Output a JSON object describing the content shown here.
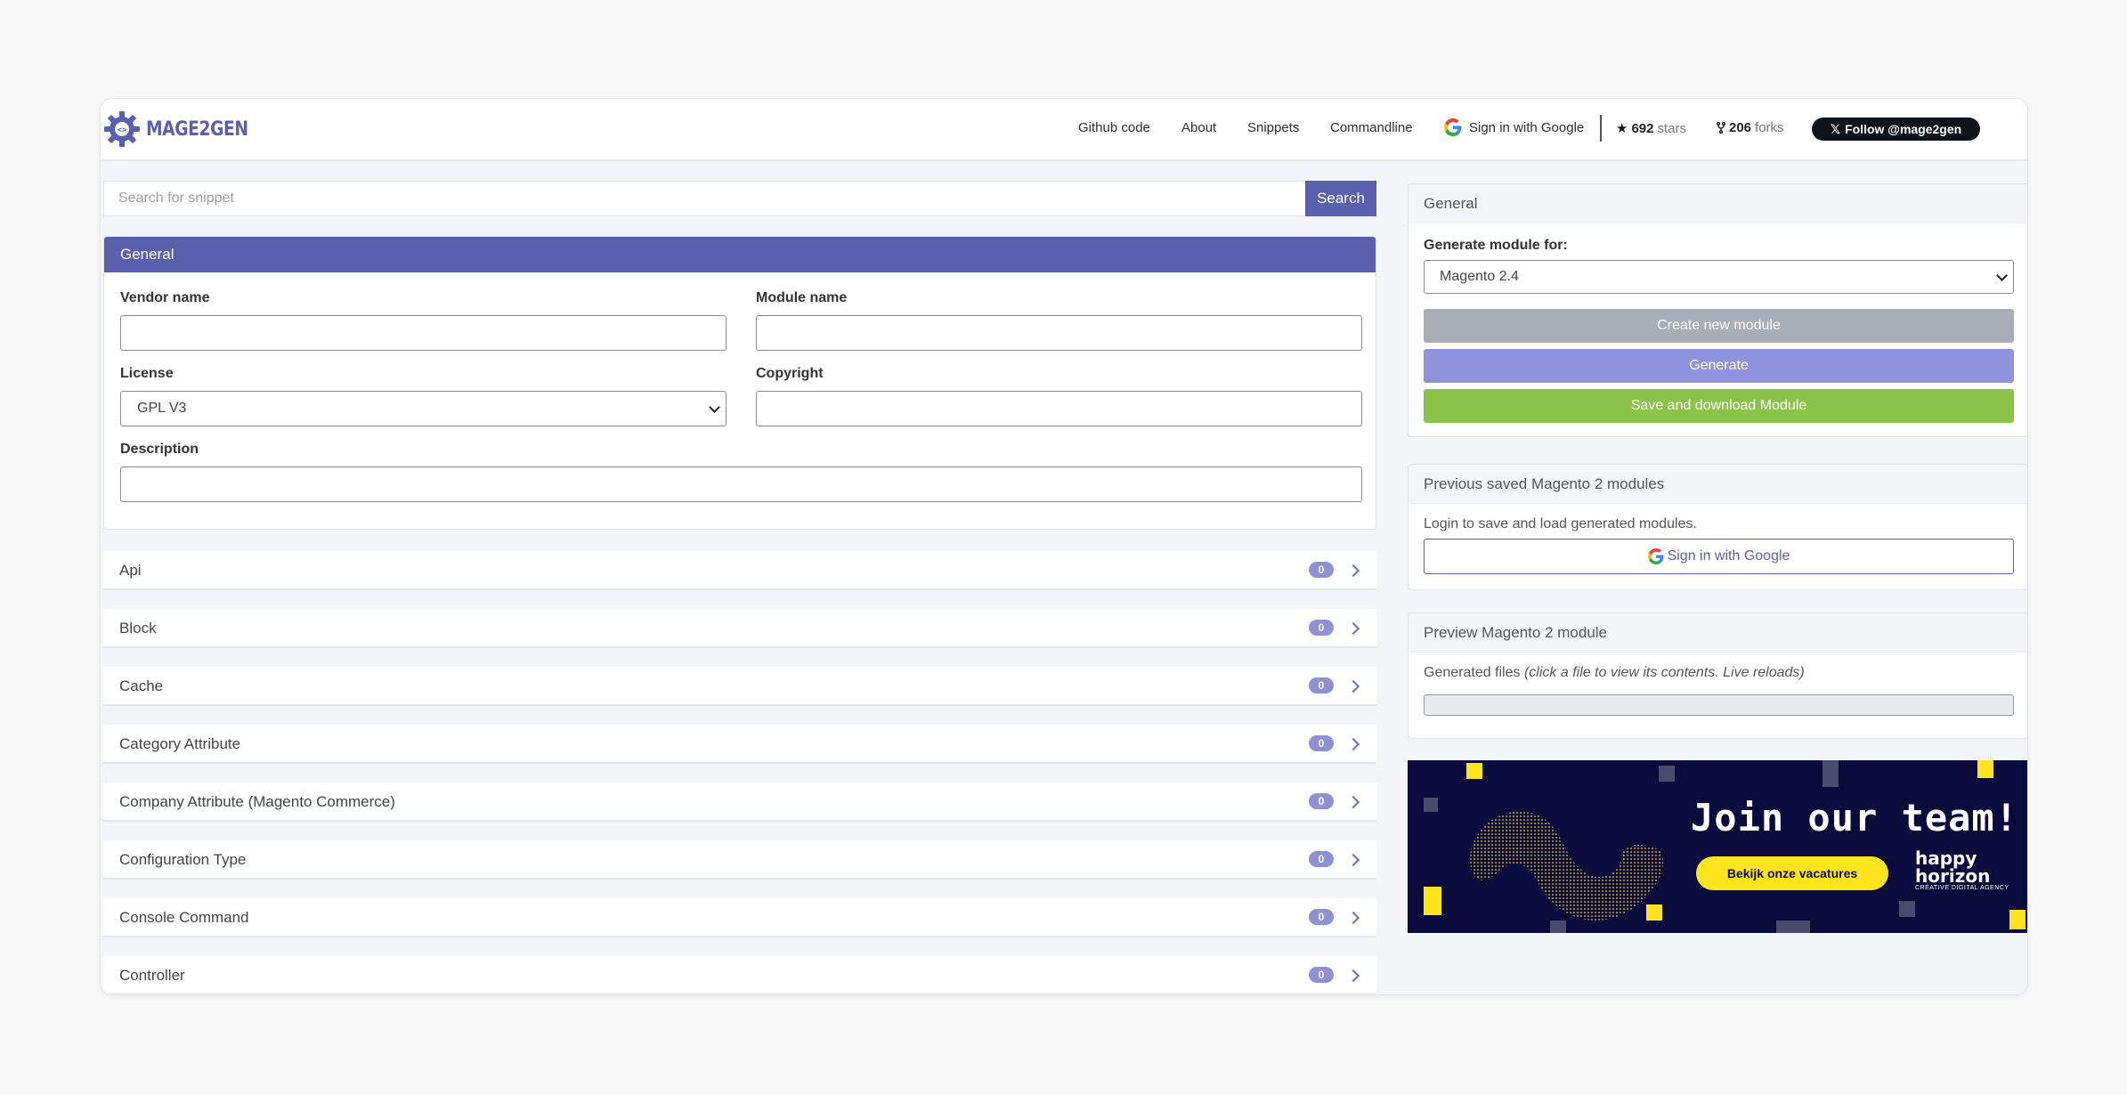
{
  "header": {
    "logo_text": "MAGE2GEN",
    "nav": [
      "Github code",
      "About",
      "Snippets",
      "Commandline"
    ],
    "sign_in_label": "Sign in with Google",
    "stars_count": "692",
    "stars_label": "stars",
    "forks_count": "206",
    "forks_label": "forks",
    "follow_label": "Follow @mage2gen"
  },
  "search": {
    "placeholder": "Search for snippet",
    "button_label": "Search"
  },
  "general": {
    "title": "General",
    "vendor_label": "Vendor name",
    "module_label": "Module name",
    "license_label": "License",
    "license_value": "GPL V3",
    "copyright_label": "Copyright",
    "description_label": "Description"
  },
  "snippets": [
    {
      "label": "Api",
      "count": "0"
    },
    {
      "label": "Block",
      "count": "0"
    },
    {
      "label": "Cache",
      "count": "0"
    },
    {
      "label": "Category Attribute",
      "count": "0"
    },
    {
      "label": "Company Attribute (Magento Commerce)",
      "count": "0"
    },
    {
      "label": "Configuration Type",
      "count": "0"
    },
    {
      "label": "Console Command",
      "count": "0"
    },
    {
      "label": "Controller",
      "count": "0"
    }
  ],
  "right_general": {
    "title": "General",
    "generate_for_label": "Generate module for:",
    "magento_version": "Magento 2.4",
    "create_label": "Create new module",
    "generate_label": "Generate",
    "save_label": "Save and download Module"
  },
  "saved": {
    "title": "Previous saved Magento 2 modules",
    "text": "Login to save and load generated modules.",
    "sign_in_label": "Sign in with Google"
  },
  "preview": {
    "title": "Preview Magento 2 module",
    "text": "Generated files",
    "hint": "(click a file to view its contents. Live reloads)"
  },
  "banner": {
    "title": "Join our team!",
    "button_label": "Bekijk onze vacatures",
    "brand_line1": "happy",
    "brand_line2": "horizon",
    "brand_sub": "CREATIVE DIGITAL AGENCY"
  },
  "colors": {
    "primary": "#5a5fae",
    "badge": "#8f92d2",
    "create_btn": "#a9adb6",
    "generate_btn": "#8f92dc",
    "save_btn": "#8bc34a",
    "banner_bg": "#0a0a3c",
    "banner_yellow": "#ffe41e"
  }
}
